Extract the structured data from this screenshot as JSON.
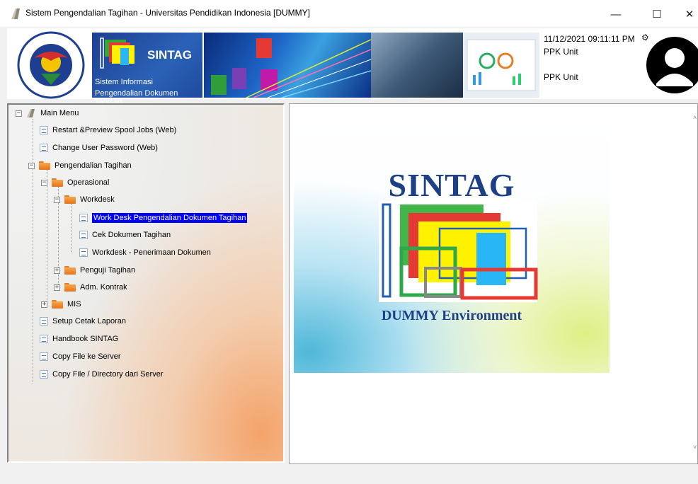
{
  "window": {
    "title": "Sistem Pengendalian Tagihan - Universitas Pendidikan Indonesia [DUMMY]",
    "minimize_glyph": "—",
    "maximize_glyph": "☐",
    "close_glyph": "✕"
  },
  "header": {
    "brand": "SINTAG",
    "subtitle_line1": "Sistem Informasi",
    "subtitle_line2": "Pengendalian Dokumen Tagihan",
    "datetime": "11/12/2021 09:11:11 PM",
    "unit_line1": "PPK Unit",
    "unit_line2": "PPK Unit",
    "settings_glyph": "⚙"
  },
  "tree": {
    "expand_open": "−",
    "expand_closed": "+",
    "items": [
      {
        "label": "Main Menu"
      },
      {
        "label": "Restart &Preview Spool Jobs (Web)"
      },
      {
        "label": "Change User Password (Web)"
      },
      {
        "label": "Pengendalian Tagihan"
      },
      {
        "label": "Operasional"
      },
      {
        "label": "Workdesk"
      },
      {
        "label": "Work Desk Pengendalian Dokumen Tagihan"
      },
      {
        "label": "Cek Dokumen Tagihan"
      },
      {
        "label": "Workdesk - Penerimaan Dokumen"
      },
      {
        "label": "Penguji Tagihan"
      },
      {
        "label": "Adm. Kontrak"
      },
      {
        "label": "MIS"
      },
      {
        "label": "Setup Cetak Laporan"
      },
      {
        "label": "Handbook SINTAG"
      },
      {
        "label": "Copy File ke Server"
      },
      {
        "label": "Copy File / Directory dari Server"
      }
    ]
  },
  "splash": {
    "title": "SINTAG",
    "environment": "DUMMY Environment"
  },
  "scroll": {
    "up_glyph": "˄",
    "down_glyph": "˅"
  },
  "colors": {
    "selection": "#0000ff",
    "brand_blue": "#1d3f86",
    "folder_orange": "#e5731a"
  }
}
